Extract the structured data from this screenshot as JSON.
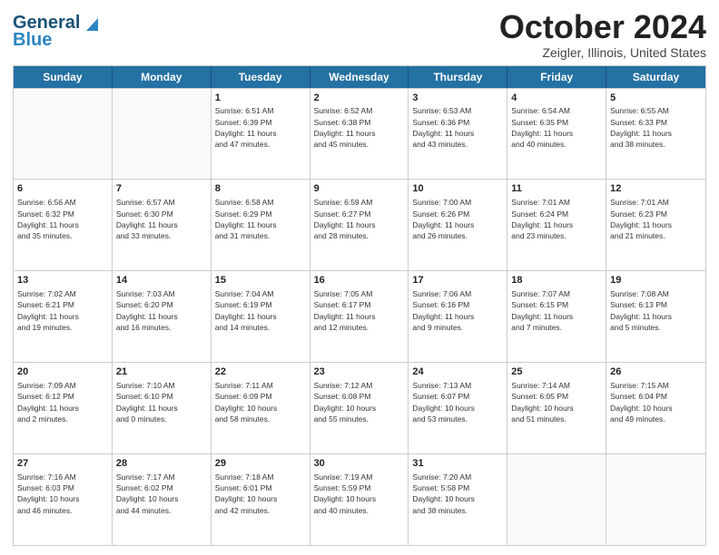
{
  "header": {
    "logo_line1": "General",
    "logo_line2": "Blue",
    "month": "October 2024",
    "location": "Zeigler, Illinois, United States"
  },
  "days_of_week": [
    "Sunday",
    "Monday",
    "Tuesday",
    "Wednesday",
    "Thursday",
    "Friday",
    "Saturday"
  ],
  "weeks": [
    [
      {
        "day": "",
        "info": ""
      },
      {
        "day": "",
        "info": ""
      },
      {
        "day": "1",
        "info": "Sunrise: 6:51 AM\nSunset: 6:39 PM\nDaylight: 11 hours\nand 47 minutes."
      },
      {
        "day": "2",
        "info": "Sunrise: 6:52 AM\nSunset: 6:38 PM\nDaylight: 11 hours\nand 45 minutes."
      },
      {
        "day": "3",
        "info": "Sunrise: 6:53 AM\nSunset: 6:36 PM\nDaylight: 11 hours\nand 43 minutes."
      },
      {
        "day": "4",
        "info": "Sunrise: 6:54 AM\nSunset: 6:35 PM\nDaylight: 11 hours\nand 40 minutes."
      },
      {
        "day": "5",
        "info": "Sunrise: 6:55 AM\nSunset: 6:33 PM\nDaylight: 11 hours\nand 38 minutes."
      }
    ],
    [
      {
        "day": "6",
        "info": "Sunrise: 6:56 AM\nSunset: 6:32 PM\nDaylight: 11 hours\nand 35 minutes."
      },
      {
        "day": "7",
        "info": "Sunrise: 6:57 AM\nSunset: 6:30 PM\nDaylight: 11 hours\nand 33 minutes."
      },
      {
        "day": "8",
        "info": "Sunrise: 6:58 AM\nSunset: 6:29 PM\nDaylight: 11 hours\nand 31 minutes."
      },
      {
        "day": "9",
        "info": "Sunrise: 6:59 AM\nSunset: 6:27 PM\nDaylight: 11 hours\nand 28 minutes."
      },
      {
        "day": "10",
        "info": "Sunrise: 7:00 AM\nSunset: 6:26 PM\nDaylight: 11 hours\nand 26 minutes."
      },
      {
        "day": "11",
        "info": "Sunrise: 7:01 AM\nSunset: 6:24 PM\nDaylight: 11 hours\nand 23 minutes."
      },
      {
        "day": "12",
        "info": "Sunrise: 7:01 AM\nSunset: 6:23 PM\nDaylight: 11 hours\nand 21 minutes."
      }
    ],
    [
      {
        "day": "13",
        "info": "Sunrise: 7:02 AM\nSunset: 6:21 PM\nDaylight: 11 hours\nand 19 minutes."
      },
      {
        "day": "14",
        "info": "Sunrise: 7:03 AM\nSunset: 6:20 PM\nDaylight: 11 hours\nand 16 minutes."
      },
      {
        "day": "15",
        "info": "Sunrise: 7:04 AM\nSunset: 6:19 PM\nDaylight: 11 hours\nand 14 minutes."
      },
      {
        "day": "16",
        "info": "Sunrise: 7:05 AM\nSunset: 6:17 PM\nDaylight: 11 hours\nand 12 minutes."
      },
      {
        "day": "17",
        "info": "Sunrise: 7:06 AM\nSunset: 6:16 PM\nDaylight: 11 hours\nand 9 minutes."
      },
      {
        "day": "18",
        "info": "Sunrise: 7:07 AM\nSunset: 6:15 PM\nDaylight: 11 hours\nand 7 minutes."
      },
      {
        "day": "19",
        "info": "Sunrise: 7:08 AM\nSunset: 6:13 PM\nDaylight: 11 hours\nand 5 minutes."
      }
    ],
    [
      {
        "day": "20",
        "info": "Sunrise: 7:09 AM\nSunset: 6:12 PM\nDaylight: 11 hours\nand 2 minutes."
      },
      {
        "day": "21",
        "info": "Sunrise: 7:10 AM\nSunset: 6:10 PM\nDaylight: 11 hours\nand 0 minutes."
      },
      {
        "day": "22",
        "info": "Sunrise: 7:11 AM\nSunset: 6:09 PM\nDaylight: 10 hours\nand 58 minutes."
      },
      {
        "day": "23",
        "info": "Sunrise: 7:12 AM\nSunset: 6:08 PM\nDaylight: 10 hours\nand 55 minutes."
      },
      {
        "day": "24",
        "info": "Sunrise: 7:13 AM\nSunset: 6:07 PM\nDaylight: 10 hours\nand 53 minutes."
      },
      {
        "day": "25",
        "info": "Sunrise: 7:14 AM\nSunset: 6:05 PM\nDaylight: 10 hours\nand 51 minutes."
      },
      {
        "day": "26",
        "info": "Sunrise: 7:15 AM\nSunset: 6:04 PM\nDaylight: 10 hours\nand 49 minutes."
      }
    ],
    [
      {
        "day": "27",
        "info": "Sunrise: 7:16 AM\nSunset: 6:03 PM\nDaylight: 10 hours\nand 46 minutes."
      },
      {
        "day": "28",
        "info": "Sunrise: 7:17 AM\nSunset: 6:02 PM\nDaylight: 10 hours\nand 44 minutes."
      },
      {
        "day": "29",
        "info": "Sunrise: 7:18 AM\nSunset: 6:01 PM\nDaylight: 10 hours\nand 42 minutes."
      },
      {
        "day": "30",
        "info": "Sunrise: 7:19 AM\nSunset: 5:59 PM\nDaylight: 10 hours\nand 40 minutes."
      },
      {
        "day": "31",
        "info": "Sunrise: 7:20 AM\nSunset: 5:58 PM\nDaylight: 10 hours\nand 38 minutes."
      },
      {
        "day": "",
        "info": ""
      },
      {
        "day": "",
        "info": ""
      }
    ]
  ]
}
